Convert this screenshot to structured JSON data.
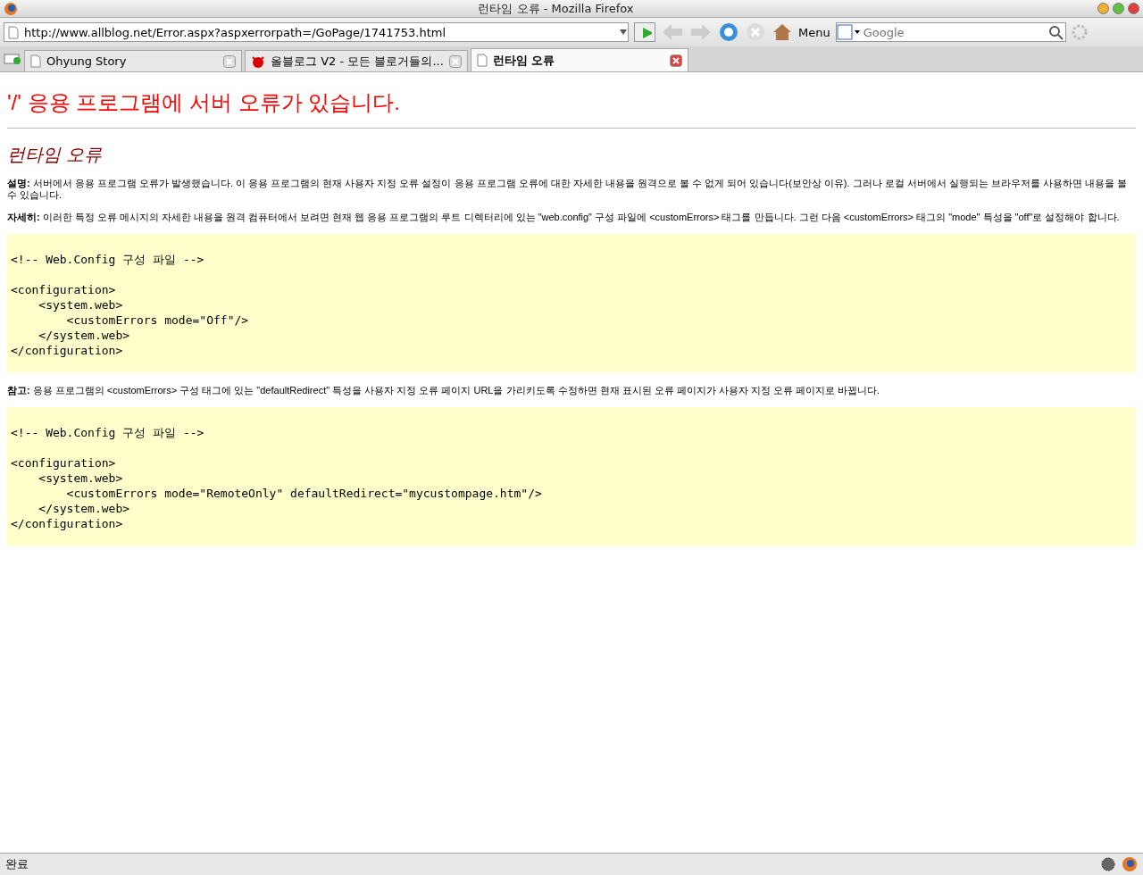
{
  "window": {
    "title": "런타임 오류 - Mozilla Firefox"
  },
  "toolbar": {
    "url": "http://www.allblog.net/Error.aspx?aspxerrorpath=/GoPage/1741753.html",
    "menu": "Menu",
    "search_placeholder": "Google"
  },
  "tabs": [
    {
      "label": "Ohyung Story",
      "selected": false,
      "kind": "page"
    },
    {
      "label": "올블로그 V2 - 모든 블로거들의...",
      "selected": false,
      "kind": "devil"
    },
    {
      "label": "런타임 오류",
      "selected": true,
      "kind": "page"
    }
  ],
  "page": {
    "heading": "'/' 응용 프로그램에 서버 오류가 있습니다.",
    "subheading": "런타임 오류",
    "blocks": [
      {
        "kind": "text",
        "text": "**설명:** 서버에서 응용 프로그램 오류가 발생했습니다. 이 응용 프로그램의 현재 사용자 지정 오류 설정이 응용 프로그램 오류에 대한 자세한 내용을 원격으로 볼 수 없게 되어 있습니다(보안상 이유). 그러나 로컬 서버에서 실행되는 브라우저를 사용하면 내용을 볼 수 있습니다."
      },
      {
        "kind": "text",
        "text": "**자세히:** 이러한 특정 오류 메시지의 자세한 내용을 원격 컴퓨터에서 보려면 현재 웹 응용 프로그램의 루트 디렉터리에 있는 \"web.config\" 구성 파일에 <customErrors> 태그를 만듭니다. 그런 다음 <customErrors> 태그의 \"mode\" 특성을 \"off\"로 설정해야 합니다."
      },
      {
        "kind": "code",
        "text": "<!-- Web.Config 구성 파일 -->\n\n<configuration>\n    <system.web>\n        <customErrors mode=\"Off\"/>\n    </system.web>\n</configuration>"
      },
      {
        "kind": "text",
        "text": "**참고:** 응용 프로그램의 <customErrors> 구성 태그에 있는 \"defaultRedirect\" 특성을 사용자 지정 오류 페이지 URL을 가리키도록 수정하면 현재 표시된 오류 페이지가 사용자 지정 오류 페이지로 바뀝니다."
      },
      {
        "kind": "code",
        "text": "<!-- Web.Config 구성 파일 -->\n\n<configuration>\n    <system.web>\n        <customErrors mode=\"RemoteOnly\" defaultRedirect=\"mycustompage.htm\"/>\n    </system.web>\n</configuration>"
      }
    ]
  },
  "status_bar": {
    "text": "완료"
  }
}
